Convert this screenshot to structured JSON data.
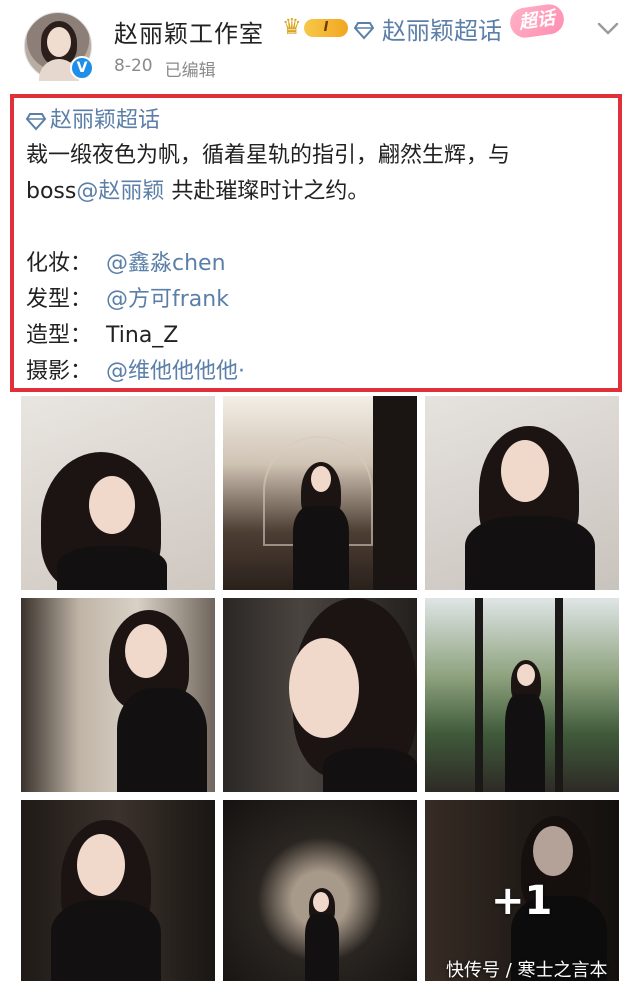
{
  "header": {
    "account_name": "赵丽颖工作室",
    "vip_level": "I",
    "super_topic_link": "赵丽颖超话",
    "super_topic_badge": "超话",
    "date": "8-20",
    "edited_label": "已编辑",
    "verified_mark": "V"
  },
  "post": {
    "topic_tag": "赵丽颖超话",
    "line1": "裁一缎夜色为帆，循着星轨的指引，翩然生辉，与",
    "line2_prefix": "boss",
    "line2_mention": "@赵丽颖",
    "line2_suffix": " 共赴璀璨时计之约。",
    "credits": [
      {
        "label": "化妆：",
        "value": "@鑫淼chen",
        "is_link": true
      },
      {
        "label": "发型：",
        "value": "@方可frank",
        "is_link": true
      },
      {
        "label": "造型：",
        "value": "Tina_Z",
        "is_link": false
      },
      {
        "label": "摄影：",
        "value": "@维他他他他·",
        "is_link": true
      }
    ]
  },
  "gallery": {
    "more_count": "+1",
    "watermark": "快传号 / 寒士之言本"
  },
  "colors": {
    "link": "#5b7fa8",
    "highlight_border": "#e0303a",
    "meta_text": "#8a8a8a"
  }
}
